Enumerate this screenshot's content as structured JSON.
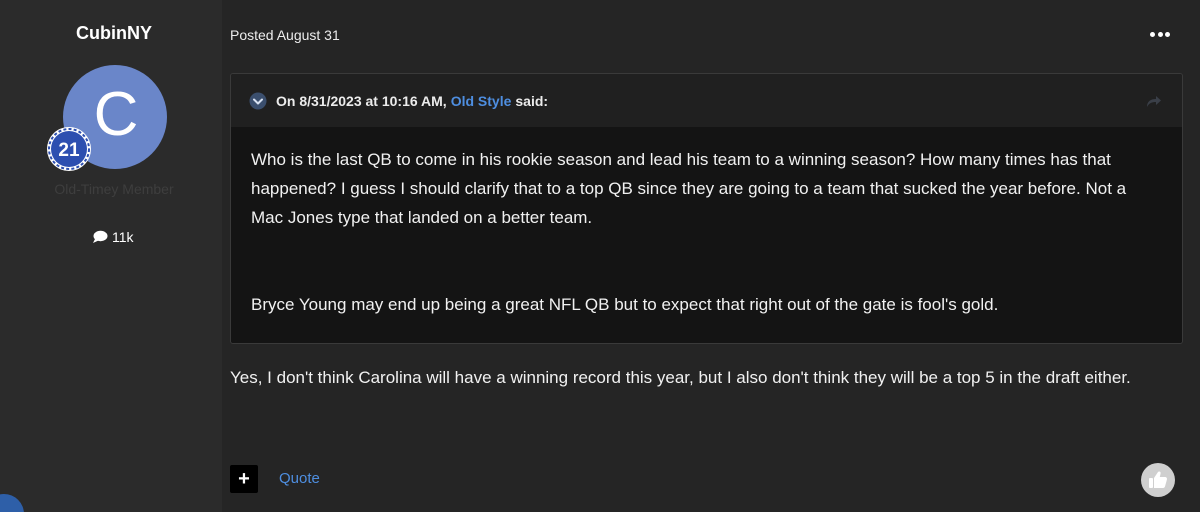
{
  "author": {
    "name": "CubinNY",
    "avatar_letter": "C",
    "avatar_color": "#6a86c9",
    "rank_badge_number": "21",
    "member_title": "Old-Timey Member",
    "post_count": "11k",
    "post_count_icon": "speech-bubble-icon"
  },
  "post": {
    "posted_label": "Posted August 31",
    "more_menu_icon": "ellipsis-icon",
    "quote": {
      "header_prefix": "On 8/31/2023 at 10:16 AM,",
      "quoted_user": "Old Style",
      "header_suffix": "said:",
      "toggle_icon": "chevron-down-circle-icon",
      "share_icon": "share-arrow-icon",
      "paragraph_1": "Who is the last QB to come in his rookie season and lead his team to a winning season? How many times has that happened? I guess I should clarify that to a top QB since they are going to a team that sucked the year before. Not a Mac Jones type that landed on a better team.",
      "paragraph_2": "Bryce Young may end up being a great NFL QB but to expect that right out of the gate is fool's gold."
    },
    "body": "Yes, I don't think Carolina will have a winning record this year, but I also don't think they will be a top 5 in the draft either.",
    "actions": {
      "multi_quote_label": "+",
      "quote_label": "Quote",
      "like_icon": "thumbs-up-icon"
    }
  },
  "colors": {
    "background": "#252525",
    "author_column": "#2b2b2b",
    "link": "#4e8ee0",
    "quote_body": "#141414"
  }
}
